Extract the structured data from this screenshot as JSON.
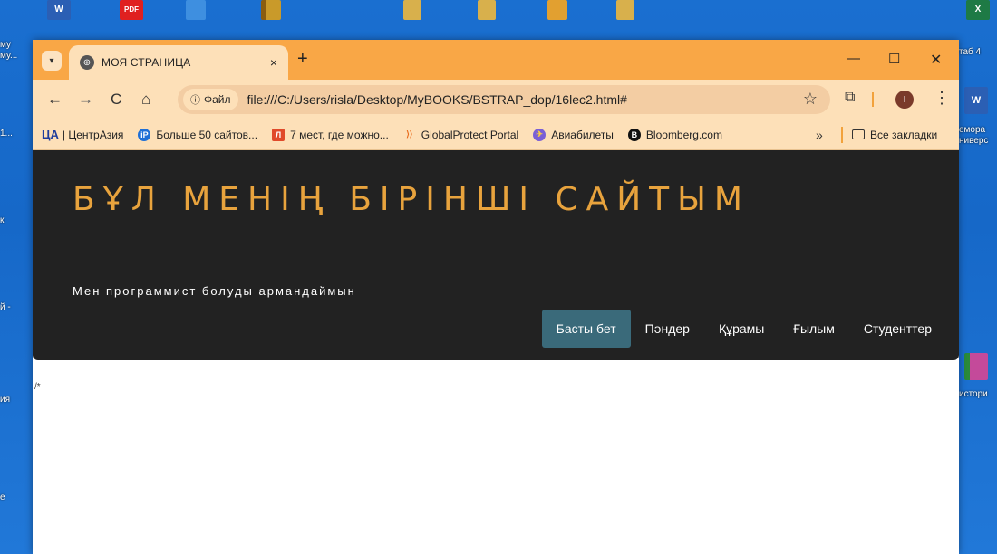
{
  "desktop": {
    "top_icons": {
      "word_label": "W",
      "pdf_label": "PDF",
      "excel_label": "X"
    },
    "left_labels": [
      "му",
      "му...",
      "1...",
      "к",
      "й -",
      "ия",
      "е"
    ],
    "right_labels": [
      "таб 4",
      "емора",
      "ниверс",
      "истори"
    ],
    "right_word_label": "W"
  },
  "browser": {
    "tab": {
      "title": "МОЯ СТРАНИЦА",
      "close": "×"
    },
    "new_tab": "+",
    "window_controls": {
      "minimize": "—",
      "maximize": "☐",
      "close": "✕"
    },
    "toolbar": {
      "back": "←",
      "forward": "→",
      "reload": "C",
      "home": "⌂",
      "site_chip_label": "Файл",
      "url": "file:///C:/Users/risla/Desktop/MyBOOKS/BSTRAP_dop/16lec2.html#",
      "star": "☆",
      "profile_initial": "I",
      "menu": "⋮"
    },
    "bookmarks": [
      {
        "prefix": "ЦА",
        "label": "| ЦентрАзия",
        "icon_color": "#1f3d9c"
      },
      {
        "icon_text": "iP",
        "label": "Больше 50 сайтов...",
        "icon_color": "#1f6fd6"
      },
      {
        "icon_text": "Л",
        "label": "7 мест, где можно...",
        "icon_color": "#e04a2a"
      },
      {
        "icon_text": "⟩⟩",
        "label": "GlobalProtect Portal",
        "icon_color": "#e86a1a"
      },
      {
        "icon_text": "✈",
        "label": "Авиабилеты",
        "icon_color": "#7a5fd6"
      },
      {
        "icon_text": "B",
        "label": "Bloomberg.com",
        "icon_color": "#111111"
      }
    ],
    "bookmarks_more": "»",
    "all_bookmarks": "Все закладки"
  },
  "page": {
    "hero_title": "БҰЛ МЕНІҢ БІРІНШІ САЙТЫМ",
    "hero_subtitle": "Мен программист болуды армандаймын",
    "nav": [
      {
        "label": "Басты бет",
        "active": true
      },
      {
        "label": "Пәндер",
        "active": false
      },
      {
        "label": "Құрамы",
        "active": false
      },
      {
        "label": "Ғылым",
        "active": false
      },
      {
        "label": "Студенттер",
        "active": false
      }
    ],
    "comment_text": "/*"
  },
  "colors": {
    "tabbar": "#f9a746",
    "toolbar": "#fde0b8",
    "hero_bg": "#222222",
    "hero_title": "#e8a33d",
    "nav_active": "#3a6a7a"
  }
}
